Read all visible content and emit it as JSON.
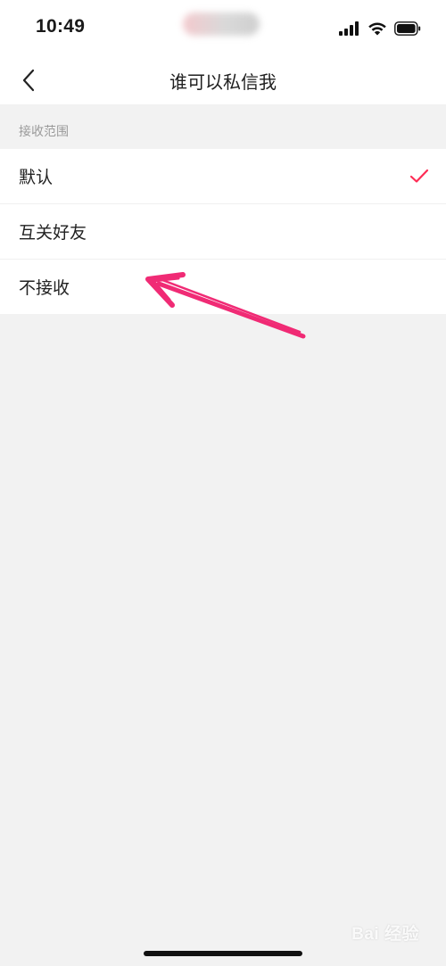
{
  "status_bar": {
    "time": "10:49"
  },
  "nav": {
    "title": "谁可以私信我"
  },
  "section": {
    "header": "接收范围"
  },
  "options": [
    {
      "label": "默认",
      "selected": true
    },
    {
      "label": "互关好友",
      "selected": false
    },
    {
      "label": "不接收",
      "selected": false
    }
  ],
  "colors": {
    "accent": "#fe2c55",
    "annotation_arrow": "#f0206e"
  },
  "watermark": {
    "text": "Bai 经验"
  }
}
